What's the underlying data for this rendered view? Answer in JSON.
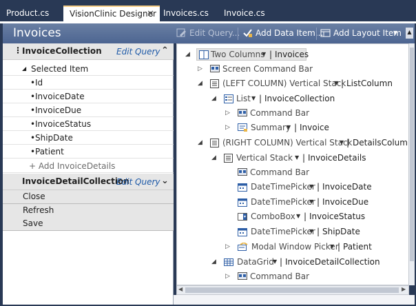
{
  "tabs": [
    {
      "label": "Product.cs"
    },
    {
      "label": "VisionClinic Designer",
      "active": true
    },
    {
      "label": "Invoices.cs"
    },
    {
      "label": "Invoice.cs"
    }
  ],
  "header": {
    "title": "Invoices",
    "edit_query": "Edit Query...",
    "add_data_item": "Add Data Item...",
    "add_layout_item": "Add Layout Item"
  },
  "left": {
    "collection1": {
      "title": "InvoiceCollection",
      "edit_query": "Edit Query",
      "selected_item": "Selected Item",
      "fields": [
        "Id",
        "InvoiceDate",
        "InvoiceDue",
        "InvoiceStatus",
        "ShipDate",
        "Patient"
      ],
      "add_details": "+ Add InvoiceDetails"
    },
    "collection2": {
      "title": "InvoiceDetailCollection",
      "edit_query": "Edit Query"
    },
    "commands": [
      "Close",
      "Refresh",
      "Save"
    ]
  },
  "tree": {
    "root": {
      "control": "Two Columns",
      "name": "Invoices"
    },
    "screen_command_bar": "Screen Command Bar",
    "left_column": {
      "control": "(LEFT COLUMN) Vertical Stack",
      "name": "ListColumn"
    },
    "list": {
      "control": "List",
      "name": "InvoiceCollection"
    },
    "list_command_bar": "Command Bar",
    "summary": {
      "control": "Summary",
      "name": "Invoice"
    },
    "right_column": {
      "control": "(RIGHT COLUMN) Vertical Stack",
      "name": "DetailsColum"
    },
    "vertical_stack": {
      "control": "Vertical Stack",
      "name": "InvoiceDetails"
    },
    "details_command_bar": "Command Bar",
    "date1": {
      "control": "DateTimePicker",
      "name": "InvoiceDate"
    },
    "date2": {
      "control": "DateTimePicker",
      "name": "InvoiceDue"
    },
    "combo": {
      "control": "ComboBox",
      "name": "InvoiceStatus"
    },
    "date3": {
      "control": "DateTimePicker",
      "name": "ShipDate"
    },
    "modal": {
      "control": "Modal Window Picker",
      "name": "Patient"
    },
    "grid": {
      "control": "DataGrid",
      "name": "InvoiceDetailCollection"
    },
    "grid_command_bar": "Command Bar"
  },
  "colors": {
    "chrome": "#293955",
    "header": "#5a6f98",
    "link": "#1e5aa8",
    "tab_accent": "#f5cc84"
  }
}
